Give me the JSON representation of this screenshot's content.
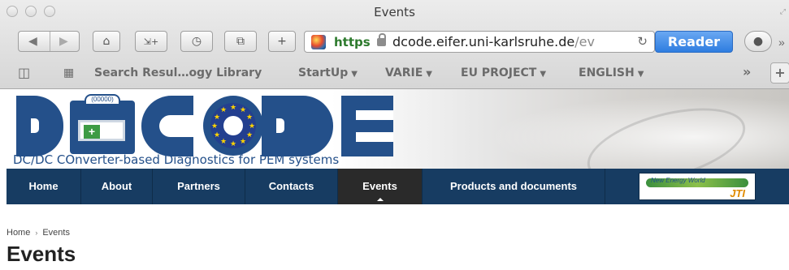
{
  "window": {
    "title": "Events"
  },
  "toolbar": {
    "url_scheme": "https",
    "url_host": "dcode.eifer.uni-karlsruhe.de",
    "url_path": "/ev",
    "reader_label": "Reader"
  },
  "bookmarks": [
    {
      "label": "Search Resul…ogy Library",
      "has_menu": false
    },
    {
      "label": "StartUp",
      "has_menu": true
    },
    {
      "label": "VARIE",
      "has_menu": true
    },
    {
      "label": "EU PROJECT",
      "has_menu": true
    },
    {
      "label": "ENGLISH",
      "has_menu": true
    }
  ],
  "site": {
    "battery_label": "(00000)",
    "tagline": "DC/DC COnverter-based Diagnostics for PEM systems",
    "nav": [
      {
        "label": "Home",
        "active": false
      },
      {
        "label": "About",
        "active": false
      },
      {
        "label": "Partners",
        "active": false
      },
      {
        "label": "Contacts",
        "active": false
      },
      {
        "label": "Events",
        "active": true
      },
      {
        "label": "Products and documents",
        "active": false
      }
    ],
    "jti_banner": {
      "line1": "New Energy World",
      "line2": "JTI"
    }
  },
  "breadcrumb": {
    "home": "Home",
    "current": "Events"
  },
  "page": {
    "title": "Events"
  },
  "colors": {
    "nav_bg": "#173c62",
    "logo_blue": "#24508a",
    "reader_blue": "#2e7de0",
    "active_nav": "#2a2a2a"
  }
}
